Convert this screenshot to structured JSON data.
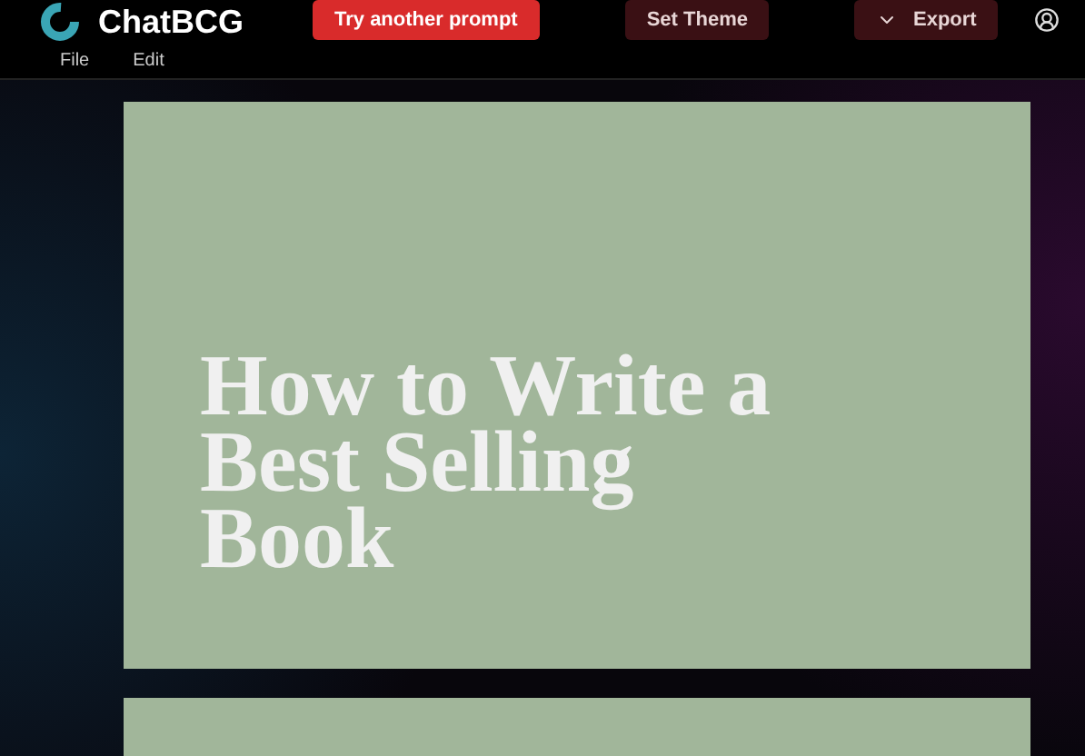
{
  "app": {
    "name": "ChatBCG"
  },
  "toolbar": {
    "buttons": [
      {
        "label": "Try another prompt",
        "kind": "primary"
      },
      {
        "label": "Set Theme",
        "kind": "secondary"
      },
      {
        "label": "Export",
        "kind": "dropdown"
      }
    ]
  },
  "menu": [
    "File",
    "Edit"
  ],
  "slides": [
    {
      "kind": "title",
      "title": "How to Write a Best Selling Book"
    },
    {
      "kind": "blank"
    }
  ]
}
